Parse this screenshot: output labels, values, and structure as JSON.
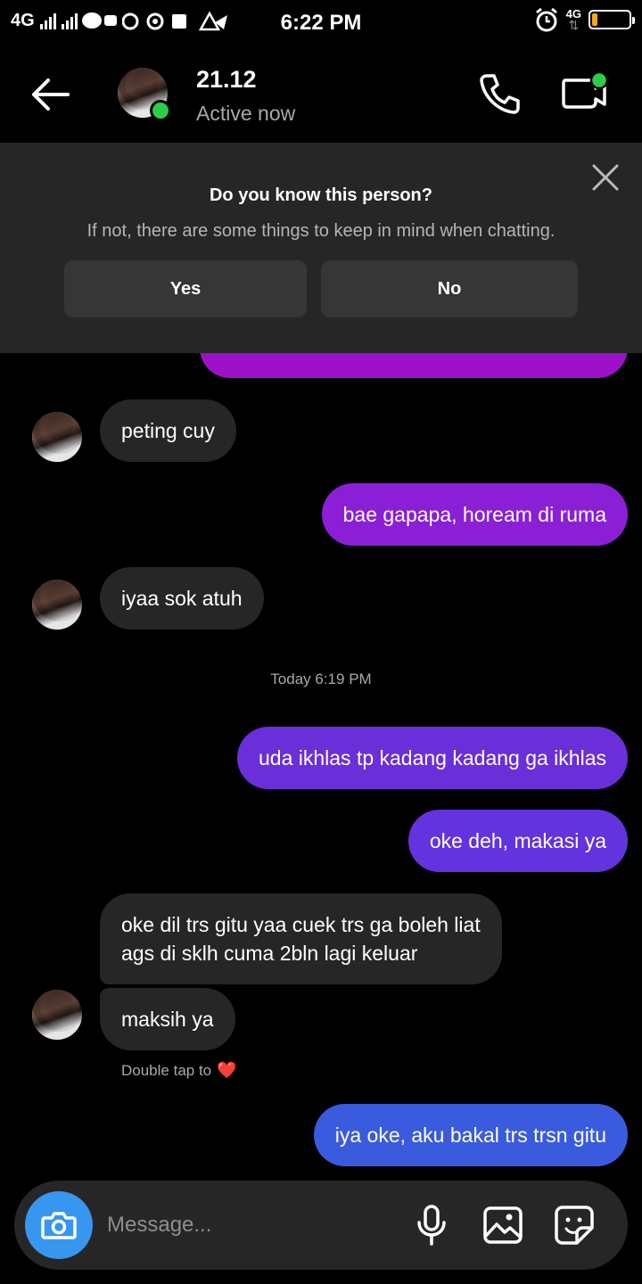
{
  "status_bar": {
    "network": "4G",
    "time": "6:22 PM",
    "network_right": "4G",
    "battery_level": 0.15,
    "battery_color": "#f5a623"
  },
  "header": {
    "name": "21.12",
    "status": "Active now",
    "online_color": "#2ecc48"
  },
  "banner": {
    "title": "Do you know this person?",
    "subtitle": "If not, there are some things to keep in mind when chatting.",
    "yes_label": "Yes",
    "no_label": "No"
  },
  "messages": [
    {
      "sender": "other",
      "text": "peting cuy"
    },
    {
      "sender": "me",
      "text": "bae gapapa, hoream di ruma",
      "color": "#8a1fd6"
    },
    {
      "sender": "other",
      "text": "iyaa sok atuh"
    },
    {
      "sender": "me",
      "text": "uda ikhlas tp kadang kadang ga ikhlas",
      "color": "#6a2fd8"
    },
    {
      "sender": "me",
      "text": "oke deh, makasi ya",
      "color": "#6233de"
    },
    {
      "sender": "other",
      "text": "oke dil trs gitu yaa cuek trs ga boleh liat",
      "text2": "ags di sklh cuma 2bln lagi keluar"
    },
    {
      "sender": "other",
      "text": "maksih ya"
    },
    {
      "sender": "me",
      "text": "iya oke, aku bakal trs trsn gitu",
      "color": "#3a5bde"
    }
  ],
  "timestamp": "Today 6:19 PM",
  "reaction_hint": "Double tap to",
  "reaction_emoji": "❤️",
  "composer": {
    "placeholder": "Message...",
    "camera_color": "#3797f0"
  },
  "icons": {
    "back": "back-arrow-icon",
    "call": "phone-icon",
    "video": "video-call-icon",
    "close": "close-icon",
    "camera": "camera-icon",
    "mic": "microphone-icon",
    "gallery": "gallery-icon",
    "sticker": "sticker-icon"
  }
}
